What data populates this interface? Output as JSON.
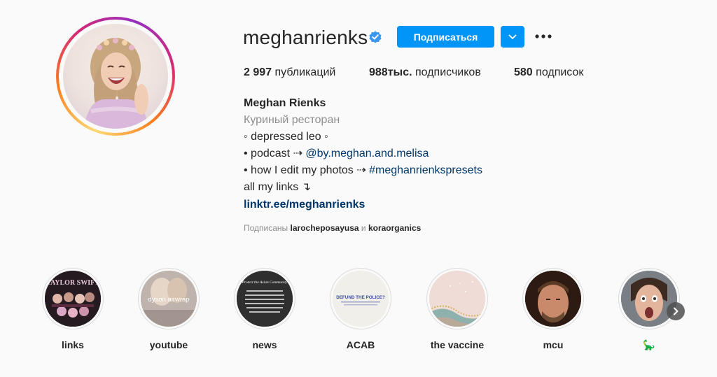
{
  "profile": {
    "username": "meghanrienks",
    "follow_label": "Подписаться",
    "stats": {
      "posts_count": "2 997",
      "posts_label": "публикаций",
      "followers_count": "988тыс.",
      "followers_label": "подписчиков",
      "following_count": "580",
      "following_label": "подписок"
    },
    "bio": {
      "name": "Meghan Rienks",
      "category": "Куриный ресторан",
      "line1": "◦ depressed leo ◦",
      "line2_prefix": "• podcast ⇢ ",
      "line2_mention": "@by.meghan.and.melisa",
      "line3_prefix": "• how I edit my photos ⇢ ",
      "line3_hashtag": "#meghanrienkspresets",
      "line4": "all my links ↴",
      "link": "linktr.ee/meghanrienks"
    },
    "followed_by": {
      "label": "Подписаны",
      "account1": "larocheposayusa",
      "conj": "и",
      "account2": "koraorganics"
    }
  },
  "highlights": [
    {
      "label": "links",
      "cover_text": "TAYLOR SWIFT"
    },
    {
      "label": "youtube",
      "cover_text": "dyson airwrap"
    },
    {
      "label": "news",
      "cover_text": "Protect the Asian Community"
    },
    {
      "label": "ACAB",
      "cover_text": "DEFUND THE POLICE?"
    },
    {
      "label": "the vaccine"
    },
    {
      "label": "mcu"
    },
    {
      "label": "🦕"
    }
  ],
  "colors": {
    "accent": "#0095f6",
    "link": "#00376b",
    "muted": "#8e8e8e",
    "text": "#262626",
    "background": "#fafafa"
  },
  "icons": [
    "verified-badge-icon",
    "chevron-down-icon",
    "more-options-icon",
    "chevron-right-icon"
  ]
}
